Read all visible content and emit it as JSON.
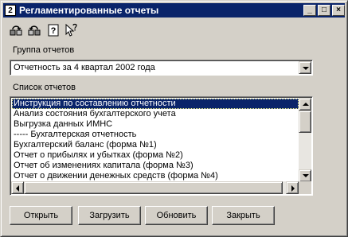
{
  "window": {
    "title": "Регламентированные отчеты",
    "icon_glyph": "2",
    "minimize_glyph": "_",
    "maximize_glyph": "□",
    "close_glyph": "×"
  },
  "toolbar": {
    "icons": [
      "connect-reports-icon",
      "disconnect-reports-icon",
      "help-icon",
      "context-help-icon"
    ],
    "help_glyph": "?"
  },
  "group": {
    "label": "Группа отчетов",
    "selected": "Отчетность за 4 квартал 2002 года"
  },
  "reports": {
    "label": "Список отчетов",
    "items": [
      "Инструкция по составлению отчетности",
      "Анализ состояния бухгалтерского учета",
      "Выгрузка данных ИМНС",
      "----- Бухгалтерская отчетность",
      "Бухгалтерский баланс (форма №1)",
      "Отчет о прибылях и убытках (форма №2)",
      "Отчет об изменениях капитала (форма №3)",
      "Отчет о движении денежных средств (форма №4)"
    ],
    "selected_index": 0
  },
  "buttons": {
    "open": "Открыть",
    "load": "Загрузить",
    "update": "Обновить",
    "close": "Закрыть"
  },
  "colors": {
    "face": "#d4d0c8",
    "title_bg": "#0a246a",
    "selection": "#0a246a"
  }
}
